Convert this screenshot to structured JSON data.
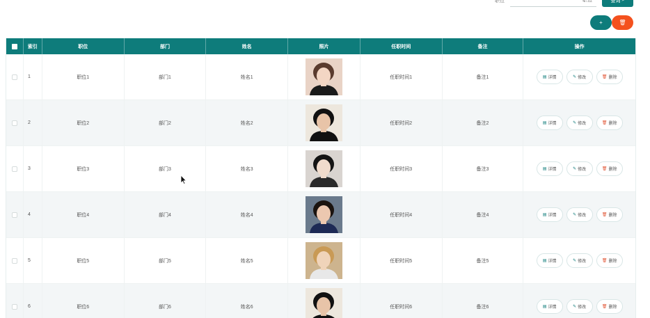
{
  "search": {
    "label": "职位",
    "placeholder": "职位",
    "button_label": "查询"
  },
  "toolbar": {
    "add_label": "+",
    "delete_label": "删"
  },
  "table": {
    "headers": {
      "index": "索引",
      "position": "职位",
      "department": "部门",
      "name": "姓名",
      "photo": "照片",
      "date": "任职时间",
      "note": "备注",
      "actions": "操作"
    },
    "actions": {
      "detail": "详情",
      "edit": "修改",
      "delete": "删除"
    },
    "rows": [
      {
        "index": "1",
        "position": "职位1",
        "department": "部门1",
        "name": "姓名1",
        "date": "任职时间1",
        "note": "备注1",
        "photo": "woman-short-hair-photo"
      },
      {
        "index": "2",
        "position": "职位2",
        "department": "部门2",
        "name": "姓名2",
        "date": "任职时间2",
        "note": "备注2",
        "photo": "man-cap-photo"
      },
      {
        "index": "3",
        "position": "职位3",
        "department": "部门3",
        "name": "姓名3",
        "date": "任职时间3",
        "note": "备注3",
        "photo": "woman-bangs-photo"
      },
      {
        "index": "4",
        "position": "职位4",
        "department": "部门4",
        "name": "姓名4",
        "date": "任职时间4",
        "note": "备注4",
        "photo": "woman-dark-hair-photo"
      },
      {
        "index": "5",
        "position": "职位5",
        "department": "部门5",
        "name": "姓名5",
        "date": "任职时间5",
        "note": "备注5",
        "photo": "man-blond-photo"
      },
      {
        "index": "6",
        "position": "职位6",
        "department": "部门6",
        "name": "姓名6",
        "date": "任职时间6",
        "note": "备注6",
        "photo": "man-cap-photo"
      }
    ]
  },
  "colors": {
    "accent": "#0e7c7b",
    "danger": "#f4511e"
  }
}
